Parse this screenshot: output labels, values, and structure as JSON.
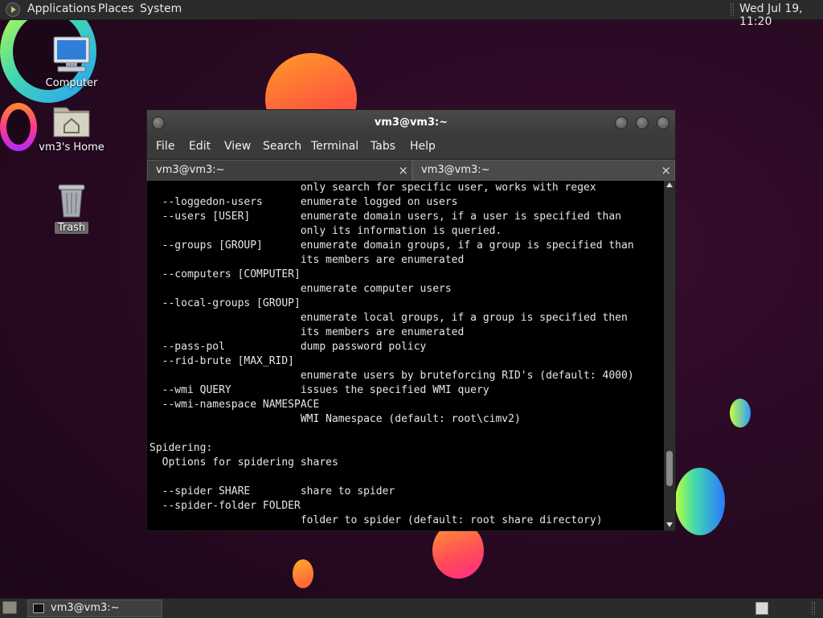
{
  "top_panel": {
    "applications": "Applications",
    "places": "Places",
    "system": "System",
    "clock": "Wed Jul 19, 11:20"
  },
  "desktop": {
    "icons": [
      {
        "label": "Computer",
        "icon": "computer-icon"
      },
      {
        "label": "vm3's Home",
        "icon": "home-folder-icon"
      },
      {
        "label": "Trash",
        "icon": "trash-icon"
      }
    ]
  },
  "terminal": {
    "title": "vm3@vm3:~",
    "menu": [
      "File",
      "Edit",
      "View",
      "Search",
      "Terminal",
      "Tabs",
      "Help"
    ],
    "tabs": [
      {
        "label": "vm3@vm3:~",
        "close": "×"
      },
      {
        "label": "vm3@vm3:~",
        "close": "×"
      }
    ],
    "content": "                        only search for specific user, works with regex\n  --loggedon-users      enumerate logged on users\n  --users [USER]        enumerate domain users, if a user is specified than\n                        only its information is queried.\n  --groups [GROUP]      enumerate domain groups, if a group is specified than\n                        its members are enumerated\n  --computers [COMPUTER]\n                        enumerate computer users\n  --local-groups [GROUP]\n                        enumerate local groups, if a group is specified then\n                        its members are enumerated\n  --pass-pol            dump password policy\n  --rid-brute [MAX_RID]\n                        enumerate users by bruteforcing RID's (default: 4000)\n  --wmi QUERY           issues the specified WMI query\n  --wmi-namespace NAMESPACE\n                        WMI Namespace (default: root\\cimv2)\n\nSpidering:\n  Options for spidering shares\n\n  --spider SHARE        share to spider\n  --spider-folder FOLDER\n                        folder to spider (default: root share directory)"
  },
  "bottom_panel": {
    "task_label": "vm3@vm3:~"
  }
}
